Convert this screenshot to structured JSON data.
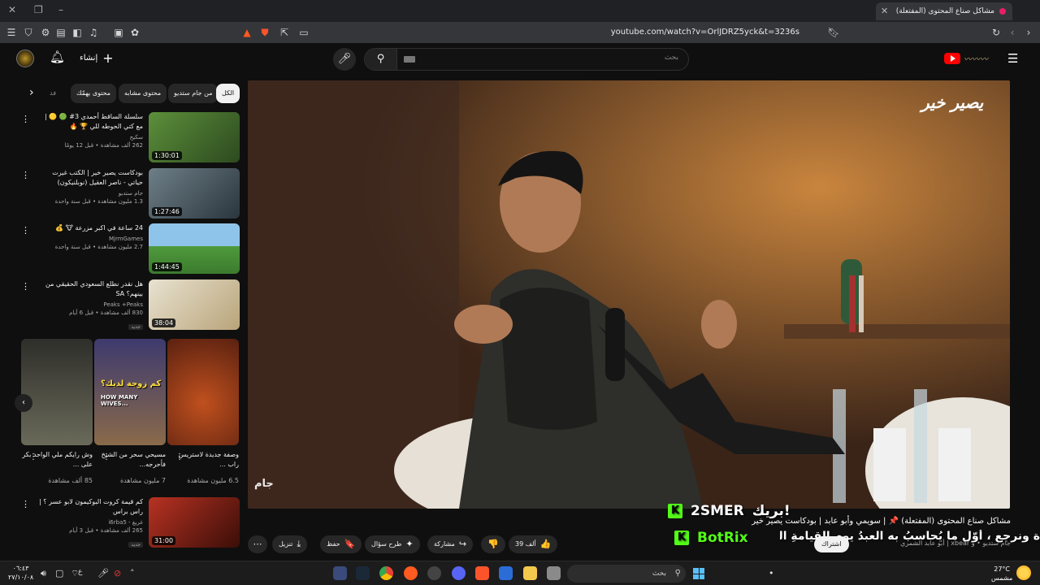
{
  "browser": {
    "tab_title": "مشاكل صناع المحتوى (المفتعلة)",
    "close": "✕",
    "new_tab": "+",
    "url": "youtube.com/watch?v=OrlJDRZ5yck&t=3236s"
  },
  "header": {
    "create_label": "إنشاء",
    "search_placeholder": "بحث"
  },
  "chips": [
    {
      "label": "الكل"
    },
    {
      "label": "من جام ستديو"
    },
    {
      "label": "محتوى مشابه"
    },
    {
      "label": "محتوى يهمّك"
    },
    {
      "label": "فد"
    }
  ],
  "recommendations": [
    {
      "title": "سلسلة الساقط أحمدي 3# 🟢 🟡 | مع كتي الحوطه للي 🏆 🔥",
      "channel": "سكيح",
      "views": "262 ألف مشاهدة • قبل 12 يومًا",
      "duration": "1:30:01",
      "thumb_bg": "#3f6f2f",
      "new_badge": ""
    },
    {
      "title": "بودكاست يصير خير | الكتب غيرت حياتي - ناصر العقيل (نوبلنيكون)",
      "channel": "جام ستديو",
      "views": "1.3 مليون مشاهدة • قبل سنة واحدة",
      "duration": "1:27:46",
      "thumb_bg": "#3a4a52",
      "new_badge": ""
    },
    {
      "title": "24 ساعة في اكبر مزرعة 🐮 💰",
      "channel": "MjrmGames",
      "views": "2.7 مليون مشاهدة • قبل سنة واحدة",
      "duration": "1:44:45",
      "thumb_bg": "#4a8a3c",
      "new_badge": ""
    },
    {
      "title": "هل نقدر نطلع السعودي الحقيقي من بينهم؟ SA",
      "channel": "Peaks +Peaks",
      "views": "830 ألف مشاهدة • قبل 6 أيام",
      "duration": "38:04",
      "thumb_bg": "#c5b48a",
      "new_badge": "جديد"
    },
    {
      "title": "كم قيمة كروت البوكيمون لابو عسر ؟ | راس براس",
      "channel": "غريغ - i6rba5",
      "views": "265 ألف مشاهدة • قبل 3 أيام",
      "duration": "31:00",
      "thumb_bg": "#8b2b1b",
      "new_badge": "جديد"
    }
  ],
  "shorts": [
    {
      "title": "وصفة جديدة لاستريس راب ...",
      "views": "6.5 مليون مشاهدة",
      "bg": "#8a3b1b"
    },
    {
      "title": "مسيحي سحر من الشيخ فأحرجه...",
      "views": "7 مليون مشاهدة",
      "bg": "#5a4a8a",
      "caption": "كم زوجة لديك؟",
      "caption_en": "HOW MANY WIVES..."
    },
    {
      "title": "وش رايكم ملي الواحد بكر على ...",
      "views": "85 ألف مشاهدة",
      "bg": "#4a4a42"
    }
  ],
  "player": {
    "logo_text": "يصير خير",
    "brand_text": "جام",
    "overlay1": "بريك!",
    "overlay1_name": "2SMER",
    "overlay2_name": "BotRix",
    "ticker": "ة ونرجع ، أوّل ما يُحاسبُ به العبدُ يوم القيامةِ الصَّلاة"
  },
  "video": {
    "title": "مشاكل صناع المحتوى (المفتعلة) 📌 | سويمي وأبو عابد | بودكاست يصير خير",
    "channel_line": "جام ستديو • و xbear | أبو عابد الشمري",
    "subscribe_label": "اشتراك"
  },
  "actions": [
    {
      "label": "39 ألف",
      "icon": "👍"
    },
    {
      "label": "",
      "icon": "👎"
    },
    {
      "label": "مشاركة",
      "icon": "↪"
    },
    {
      "label": "طرح سؤال",
      "icon": "✦"
    },
    {
      "label": "حفظ",
      "icon": "🔖"
    },
    {
      "label": "تنزيل",
      "icon": "⤓"
    },
    {
      "label": "",
      "icon": "⋯"
    }
  ],
  "taskbar": {
    "time": "٠٦:٤٣",
    "date": "٢٧/١٠/٠٨",
    "lang": "ع",
    "search_label": "بحث",
    "weather_temp": "27°C",
    "weather_desc": "مشمس"
  },
  "colors": {
    "background": "#0f0f0f",
    "chip_bg": "#272727",
    "accent_red": "#ff0000",
    "kick_green": "#53fc18"
  }
}
